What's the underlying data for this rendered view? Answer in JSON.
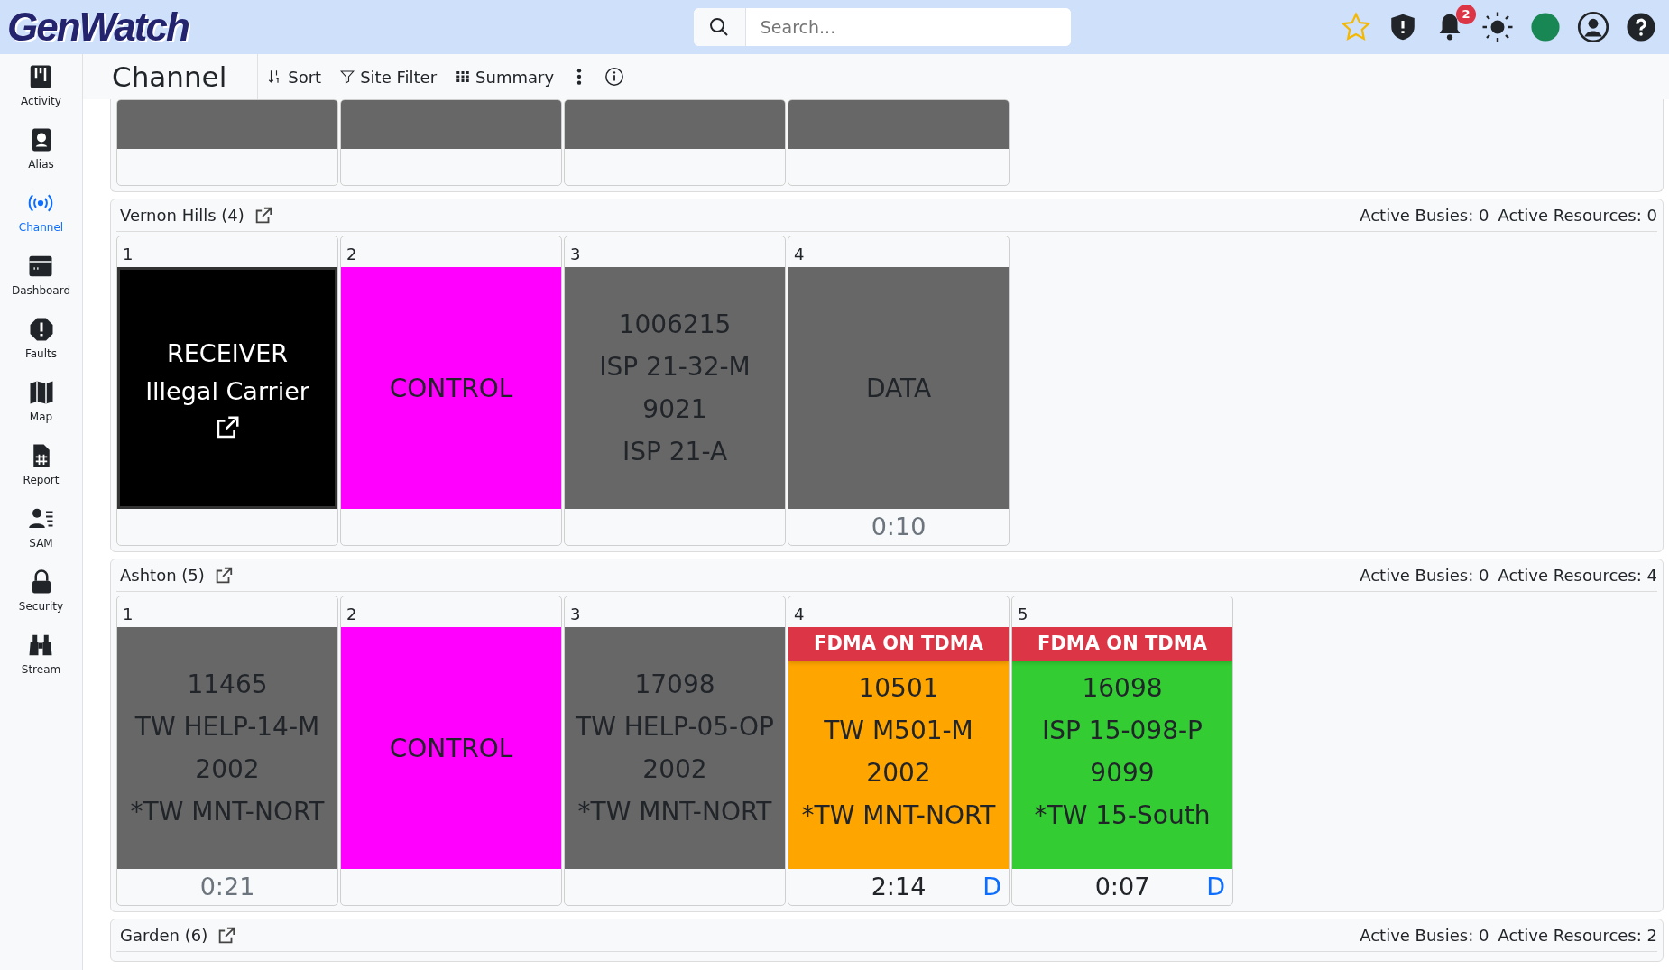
{
  "app": {
    "logo": "GenWatch"
  },
  "search": {
    "placeholder": "Search..."
  },
  "notifications": {
    "count": "2"
  },
  "sidebar": {
    "items": [
      {
        "label": "Activity",
        "selected": false
      },
      {
        "label": "Alias",
        "selected": false
      },
      {
        "label": "Channel",
        "selected": true
      },
      {
        "label": "Dashboard",
        "selected": false
      },
      {
        "label": "Faults",
        "selected": false
      },
      {
        "label": "Map",
        "selected": false
      },
      {
        "label": "Report",
        "selected": false
      },
      {
        "label": "SAM",
        "selected": false
      },
      {
        "label": "Security",
        "selected": false
      },
      {
        "label": "Stream",
        "selected": false
      }
    ]
  },
  "page": {
    "title": "Channel",
    "toolbar": [
      {
        "label": "Sort"
      },
      {
        "label": "Site Filter"
      },
      {
        "label": "Summary"
      }
    ]
  },
  "sites": [
    {
      "clipped_top": true,
      "tiles": [
        {
          "kind": "solid",
          "color": "#676767"
        },
        {
          "kind": "solid",
          "color": "#676767"
        },
        {
          "kind": "solid",
          "color": "#676767"
        },
        {
          "kind": "solid",
          "color": "#676767"
        }
      ]
    },
    {
      "clipped_top": false,
      "name": "Vernon Hills (4)",
      "busies": "Active Busies: 0",
      "resources": "Active Resources: 0",
      "tiles": [
        {
          "kind": "receiver",
          "number": "1",
          "color": "#000000",
          "lines": [
            "RECEIVER",
            "Illegal Carrier"
          ]
        },
        {
          "kind": "solid",
          "number": "2",
          "color": "#ff00ff",
          "lines": [
            "CONTROL"
          ]
        },
        {
          "kind": "solid",
          "number": "3",
          "color": "#676767",
          "lines": [
            "1006215",
            "ISP 21-32-M",
            "9021",
            "ISP 21-A"
          ]
        },
        {
          "kind": "solid",
          "number": "4",
          "color": "#676767",
          "lines": [
            "DATA"
          ],
          "timer": "0:10"
        }
      ]
    },
    {
      "clipped_top": false,
      "name": "Ashton (5)",
      "busies": "Active Busies: 0",
      "resources": "Active Resources: 4",
      "tiles": [
        {
          "kind": "solid",
          "number": "1",
          "color": "#676767",
          "lines": [
            "11465",
            "TW HELP-14-M",
            "2002",
            "*TW MNT-NORT"
          ],
          "timer": "0:21"
        },
        {
          "kind": "solid",
          "number": "2",
          "color": "#ff00ff",
          "lines": [
            "CONTROL"
          ]
        },
        {
          "kind": "solid",
          "number": "3",
          "color": "#676767",
          "lines": [
            "17098",
            "TW HELP-05-OP",
            "2002",
            "*TW MNT-NORT"
          ]
        },
        {
          "kind": "solid",
          "number": "4",
          "color": "#ffa500",
          "alert": "FDMA ON TDMA",
          "lines": [
            "10501",
            "TW M501-M",
            "2002",
            "*TW MNT-NORT"
          ],
          "timer": "2:14",
          "flag": "D"
        },
        {
          "kind": "solid",
          "number": "5",
          "color": "#33cc33",
          "alert": "FDMA ON TDMA",
          "lines": [
            "16098",
            "ISP 15-098-P",
            "9099",
            "*TW 15-South"
          ],
          "timer": "0:07",
          "flag": "D"
        }
      ]
    },
    {
      "clipped_top": false,
      "name": "Garden (6)",
      "busies": "Active Busies: 0",
      "resources": "Active Resources: 2"
    }
  ]
}
